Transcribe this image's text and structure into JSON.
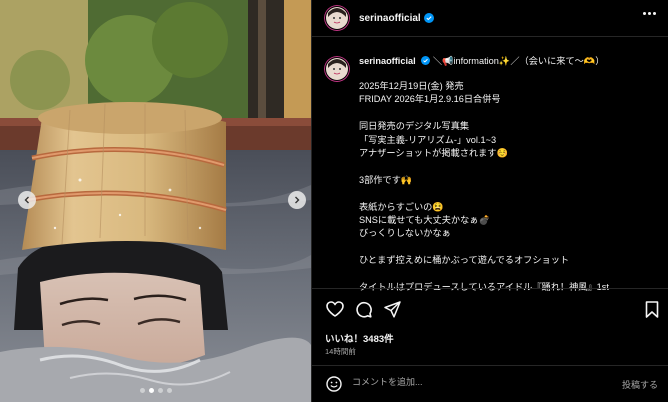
{
  "colors": {
    "accent": "#0095f6",
    "background": "#000000",
    "text": "#f5f5f5",
    "muted": "#a8a8a8",
    "divider": "#262626"
  },
  "post": {
    "username": "serinaofficial",
    "caption_username": "serinaofficial",
    "caption_first_line": "＼📢information✨／（会いに来て〜🫶）",
    "caption_lines": [
      "2025年12月19日(金) 発売",
      "FRIDAY 2026年1月2.9.16日合併号",
      "",
      "同日発売のデジタル写真集",
      "「写実主義-リアリズム-」vol.1~3",
      "アナザーショットが掲載されます☺️",
      "",
      "3部作です🙌",
      "",
      "表紙からすごいの😫",
      "SNSに載せても大丈夫かなぁ💣",
      "びっくりしないかなぁ",
      "",
      "ひとまず控えめに桶かぶって遊んでるオフショット",
      "",
      "タイトルはプロデュースしているアイドル『踊れ！神風』1st"
    ],
    "likes": "いいね！3483件",
    "time_ago": "14時間前"
  },
  "comment": {
    "placeholder": "コメントを追加...",
    "post_label": "投稿する"
  },
  "icons": {
    "more": "more-options-icon",
    "verified": "verified-badge-icon",
    "like": "heart-icon",
    "comment": "comment-icon",
    "share": "send-icon",
    "save": "bookmark-icon",
    "emoji": "emoji-icon",
    "prev": "chevron-left-icon",
    "next": "chevron-right-icon"
  },
  "carousel": {
    "slides": 4,
    "current": 1
  }
}
